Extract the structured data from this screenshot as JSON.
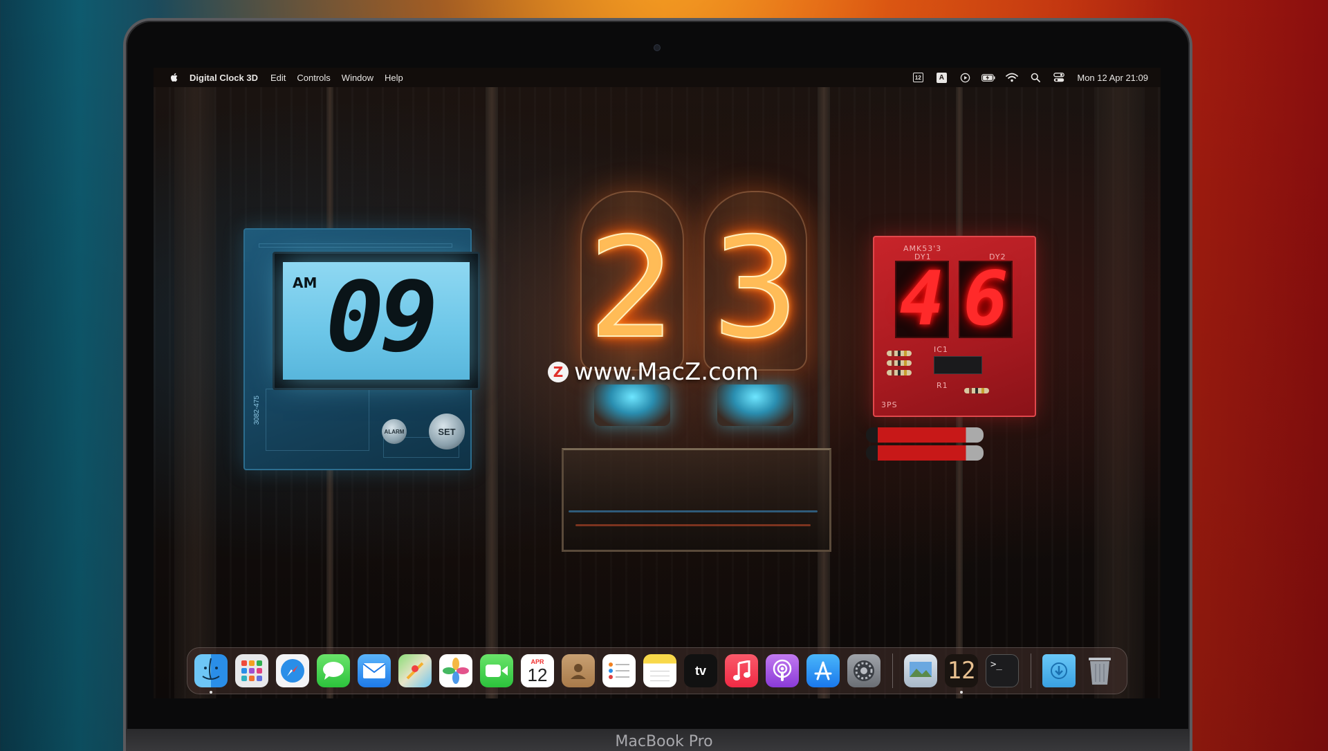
{
  "menubar": {
    "app_name": "Digital Clock 3D",
    "items": [
      "Edit",
      "Controls",
      "Window",
      "Help"
    ],
    "status_icons": [
      "calendar-status-icon",
      "keyboard-input-icon",
      "play-status-icon",
      "battery-icon",
      "wifi-icon",
      "spotlight-search-icon",
      "control-center-icon"
    ],
    "calendar_day": "12",
    "input_letter": "A",
    "clock": "Mon 12 Apr  21:09"
  },
  "clocks": {
    "lcd": {
      "meridiem": "AM",
      "hours": "09",
      "alarm_label": "ALARM",
      "set_label": "SET",
      "board_code": "3082-475"
    },
    "nixie": {
      "digit1": "2",
      "digit2": "3"
    },
    "red": {
      "digit1": "4",
      "digit2": "6",
      "board_label": "AMK53'3",
      "dy1": "DY1",
      "dy2": "DY2",
      "ic1": "IC1",
      "r1": "R1",
      "bps": "3PS"
    }
  },
  "watermark": {
    "logo": "Z",
    "text": "www.MacZ.com"
  },
  "dock": {
    "apps": [
      {
        "name": "finder-icon",
        "running": true
      },
      {
        "name": "launchpad-icon",
        "running": false
      },
      {
        "name": "safari-icon",
        "running": false
      },
      {
        "name": "messages-icon",
        "running": false
      },
      {
        "name": "mail-icon",
        "running": false
      },
      {
        "name": "maps-icon",
        "running": false
      },
      {
        "name": "photos-icon",
        "running": false
      },
      {
        "name": "facetime-icon",
        "running": false
      },
      {
        "name": "calendar-icon",
        "running": false
      },
      {
        "name": "contacts-icon",
        "running": false
      },
      {
        "name": "reminders-icon",
        "running": false
      },
      {
        "name": "notes-icon",
        "running": false
      },
      {
        "name": "apple-tv-icon",
        "running": false
      },
      {
        "name": "music-icon",
        "running": false
      },
      {
        "name": "podcasts-icon",
        "running": false
      },
      {
        "name": "app-store-icon",
        "running": false
      },
      {
        "name": "system-preferences-icon",
        "running": false
      }
    ],
    "calendar_month": "APR",
    "calendar_day": "12",
    "tv_label": "tv",
    "recent_apps": [
      {
        "name": "preview-icon",
        "running": false
      },
      {
        "name": "digital-clock-3d-icon",
        "running": true
      },
      {
        "name": "terminal-icon",
        "running": false
      }
    ],
    "clock_app_text": "12",
    "terminal_prompt": ">_",
    "folders": [
      {
        "name": "downloads-folder-icon"
      },
      {
        "name": "trash-icon"
      }
    ]
  },
  "device_label": "MacBook Pro"
}
